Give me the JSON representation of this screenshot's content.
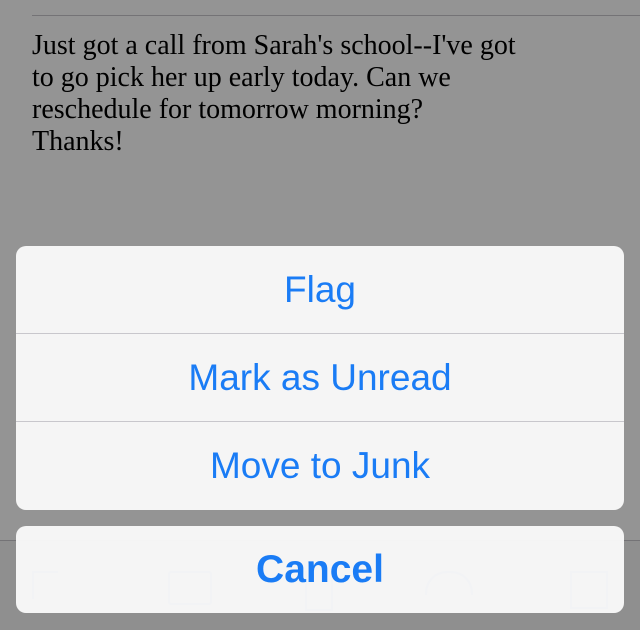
{
  "email": {
    "body": "Just got a call from Sarah's school--I've got\nto go pick her up early today. Can we\nreschedule for tomorrow morning?\nThanks!"
  },
  "toolbar": {
    "icons": [
      "flag-icon",
      "folder-icon",
      "trash-icon",
      "reply-icon",
      "compose-icon"
    ]
  },
  "action_sheet": {
    "actions": [
      "Flag",
      "Mark as Unread",
      "Move to Junk"
    ],
    "cancel_label": "Cancel",
    "accent_color": "#1a7cf5"
  }
}
